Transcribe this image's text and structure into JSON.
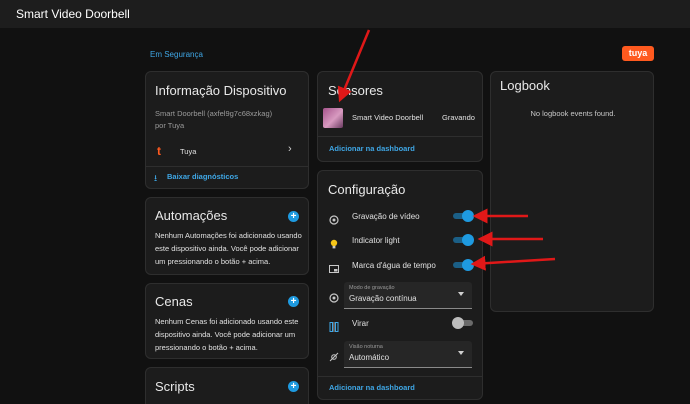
{
  "app": {
    "title": "Smart Video Doorbell"
  },
  "breadcrumb": "Em Segurança",
  "brand": {
    "logo_text": "tuya",
    "color": "#ff5a1f"
  },
  "device_info": {
    "title": "Informação Dispositivo",
    "model": "Smart Doorbell (axfel9g7c68xzkag)",
    "manufacturer": "por Tuya",
    "integration": "Tuya",
    "download_link": "Baixar diagnósticos"
  },
  "automations": {
    "title": "Automações",
    "body": "Nenhum Automações foi adicionado usando este dispositivo ainda. Você pode adicionar um pressionando o botão + acima."
  },
  "scenes": {
    "title": "Cenas",
    "body": "Nenhum Cenas foi adicionado usando este dispositivo ainda. Você pode adicionar um pressionando o botão + acima."
  },
  "scripts": {
    "title": "Scripts"
  },
  "sensors": {
    "title": "Sensores",
    "entity_name": "Smart Video Doorbell",
    "entity_state": "Gravando",
    "add_link": "Adicionar na dashboard"
  },
  "configuration": {
    "title": "Configuração",
    "rows": [
      {
        "label": "Gravação de vídeo",
        "icon": "record-icon",
        "on": true
      },
      {
        "label": "Indicator light",
        "icon": "bulb-icon",
        "on": true
      },
      {
        "label": "Marca d'água de tempo",
        "icon": "watermark-icon",
        "on": true
      }
    ],
    "recording_mode": {
      "label": "Modo de gravação",
      "value": "Gravação contínua"
    },
    "flip": {
      "label": "Virar",
      "on": false
    },
    "night_vision": {
      "label": "Visão noturna",
      "value": "Automático"
    },
    "add_link": "Adicionar na dashboard"
  },
  "logbook": {
    "title": "Logbook",
    "empty": "No logbook events found."
  },
  "colors": {
    "accent": "#1e9ae0",
    "link": "#3fa7e6",
    "annotation": "#e01818"
  }
}
